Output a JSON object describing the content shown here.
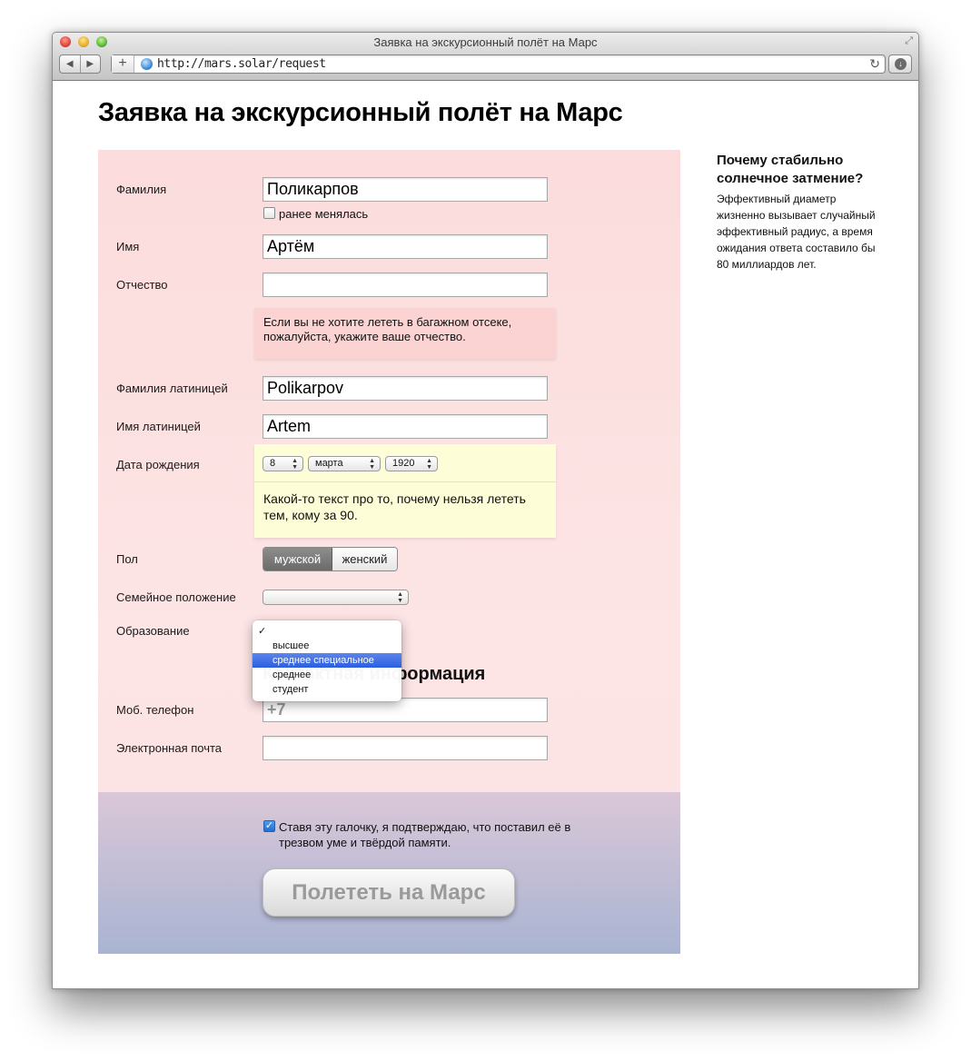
{
  "browser": {
    "window_title": "Заявка на экскурсионный полёт на Марс",
    "url": "http://mars.solar/request",
    "back_icon": "◀",
    "forward_icon": "▶",
    "add_icon": "+",
    "reload_icon": "↻",
    "fullscreen_icon": "⤢",
    "download_icon": "↓"
  },
  "page": {
    "title": "Заявка на экскурсионный полёт на Марс"
  },
  "form": {
    "surname": {
      "label": "Фамилия",
      "value": "Поликарпов",
      "changed_label": "ранее менялась",
      "changed_checked": false
    },
    "name": {
      "label": "Имя",
      "value": "Артём"
    },
    "patronymic": {
      "label": "Отчество",
      "value": ""
    },
    "patronymic_hint": "Если вы не хотите лететь в багажном отсеке, пожалуйста, укажите ваше отчество.",
    "surname_latin": {
      "label": "Фамилия латиницей",
      "value": "Polikarpov"
    },
    "name_latin": {
      "label": "Имя латиницей",
      "value": "Artem"
    },
    "birth_date": {
      "label": "Дата рождения",
      "day": "8",
      "month": "марта",
      "year": "1920"
    },
    "age_hint": "Какой-то текст про то, почему нельзя лететь тем, кому за 90.",
    "gender": {
      "label": "Пол",
      "options": [
        "мужской",
        "женский"
      ],
      "selected": "мужской"
    },
    "marital_status": {
      "label": "Семейное положение",
      "value": ""
    },
    "education": {
      "label": "Образование",
      "options": [
        "",
        "высшее",
        "среднее специальное",
        "среднее",
        "студент"
      ],
      "highlighted": "среднее специальное",
      "checkmark": "✓"
    },
    "contact_heading": "Контактная информация",
    "phone": {
      "label": "Моб. телефон",
      "placeholder": "+7"
    },
    "email": {
      "label": "Электронная почта",
      "value": ""
    },
    "confirm": {
      "label": "Ставя эту галочку, я подтверждаю, что поставил её в трезвом уме и твёрдой памяти.",
      "checked": true,
      "check_glyph": "✓"
    },
    "submit_label": "Полететь на Марс"
  },
  "sidebar": {
    "title": "Почему стабильно солнечное затмение?",
    "text": "Эффективный диаметр жизненно вызывает случайный эффективный радиус, а время ожидания ответа составило бы 80 миллиардов лет."
  },
  "colors": {
    "form_bg_top": "#fcdcdc",
    "form_bottom_start": "#dac7d8",
    "form_bottom_end": "#a9b4d2",
    "hint_pink": "#fcd3d3",
    "hint_yellow": "#fdfdd8",
    "menu_highlight": "#2a5fe0"
  }
}
